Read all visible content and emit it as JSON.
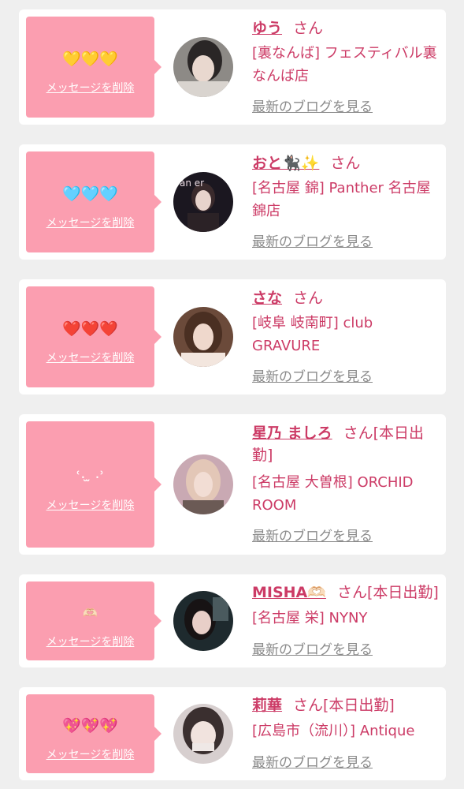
{
  "messages": [
    {
      "emoji": "💛💛💛",
      "delete_label": "メッセージを削除",
      "name": "ゆう",
      "suffix": "さん",
      "shop": "[裏なんば] フェスティバル裏なんば店",
      "blog": "最新のブログを見る",
      "avatar": "avatar-photo"
    },
    {
      "emoji": "🩵🩵🩵",
      "delete_label": "メッセージを削除",
      "name": "おと🐈‍⬛✨",
      "suffix": "さん",
      "shop": "[名古屋 錦] Panther 名古屋錦店",
      "blog": "最新のブログを見る",
      "avatar": "avatar-photo"
    },
    {
      "emoji": "❤️❤️❤️",
      "delete_label": "メッセージを削除",
      "name": "さな",
      "suffix": "さん",
      "shop": "[岐阜 岐南町] club GRAVURE",
      "blog": "最新のブログを見る",
      "avatar": "avatar-photo"
    },
    {
      "emoji": "˓.  ̫ .˒",
      "delete_label": "メッセージを削除",
      "name": "星乃 ましろ",
      "suffix": "さん[本日出勤]",
      "shop": "[名古屋 大曽根] ORCHID ROOM",
      "blog": "最新のブログを見る",
      "avatar": "avatar-photo"
    },
    {
      "emoji": "🫶🏻",
      "delete_label": "メッセージを削除",
      "name": "MISHA🫶🏻",
      "suffix": "さん[本日出勤]",
      "shop": "[名古屋 栄] NYNY",
      "blog": "最新のブログを見る",
      "avatar": "avatar-photo"
    },
    {
      "emoji": "💖💖💖",
      "delete_label": "メッセージを削除",
      "name": "莉華",
      "suffix": "さん[本日出勤]",
      "shop": "[広島市（流川）] Antique",
      "blog": "最新のブログを見る",
      "avatar": "avatar-photo"
    }
  ],
  "colors": {
    "accent": "#cc3b66",
    "bubble": "#fb9eb0",
    "card": "#ffffff",
    "background": "#efefef",
    "muted": "#8a8a8a"
  }
}
